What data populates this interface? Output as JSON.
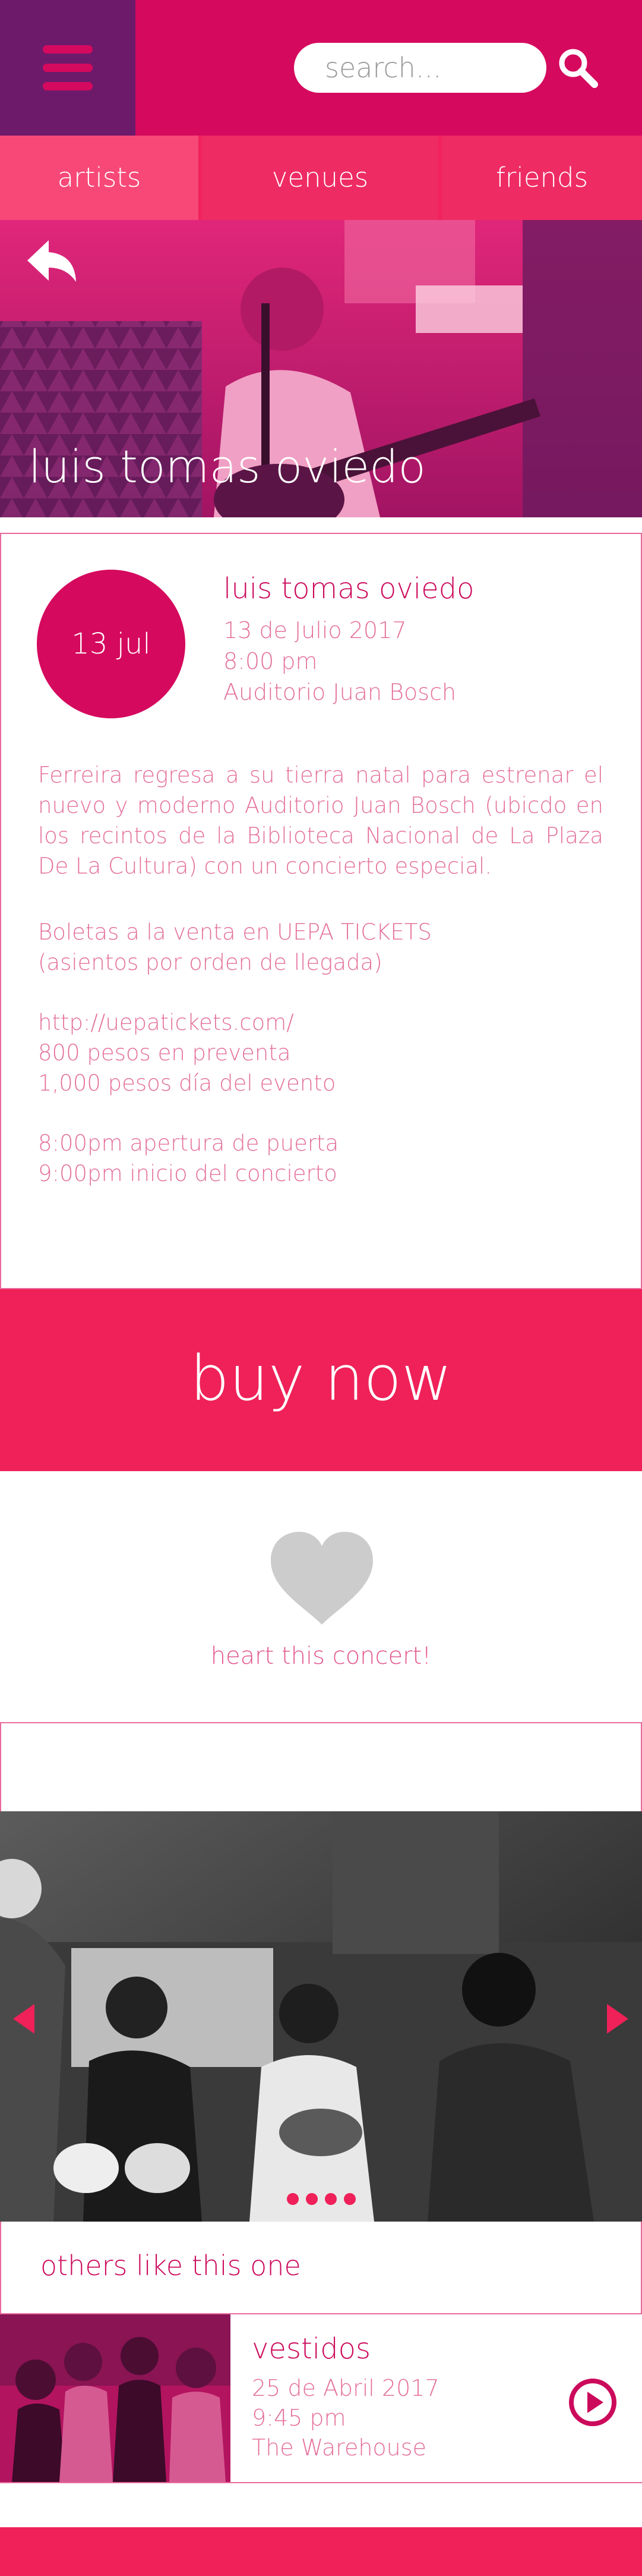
{
  "header": {
    "search_placeholder": "search...",
    "menu_icon": "hamburger-menu-icon",
    "search_icon": "magnifier-icon"
  },
  "tabs": [
    {
      "label": "artists",
      "active": true
    },
    {
      "label": "venues",
      "active": false
    },
    {
      "label": "friends",
      "active": false
    }
  ],
  "hero": {
    "title": "luis tomas oviedo",
    "back_icon": "back-arrow-icon"
  },
  "event": {
    "date_badge": "13 jul",
    "title": "luis tomas oviedo",
    "date": "13 de Julio 2017",
    "time": "8:00 pm",
    "venue": "Auditorio Juan Bosch",
    "description": "Ferreira regresa a su tierra natal para estrenar el nuevo y moderno Auditorio Juan Bosch (ubicdo en los recintos de la Biblioteca Nacional de La Plaza De La Cultura) con un concierto especial.",
    "lines": [
      "Boletas a la venta en UEPA TICKETS",
      "(asientos por orden de llegada)",
      "http://uepatickets.com/",
      "800 pesos en preventa",
      "1,000 pesos día del evento",
      "8:00pm apertura de puerta",
      "9:00pm inicio del concierto"
    ]
  },
  "buy": {
    "label": "buy now"
  },
  "heart": {
    "label": "heart this concert!",
    "icon": "heart-icon"
  },
  "gallery": {
    "slide_count": 4
  },
  "others": {
    "title": "others like this one",
    "items": [
      {
        "title": "vestidos",
        "date": "25 de Abril 2017",
        "time": "9:45 pm",
        "venue": "The Warehouse"
      }
    ]
  },
  "colors": {
    "brand": "#d5095e",
    "accent": "#ef2158",
    "purple": "#6e1a6b",
    "text_pink": "#e46f9b"
  }
}
